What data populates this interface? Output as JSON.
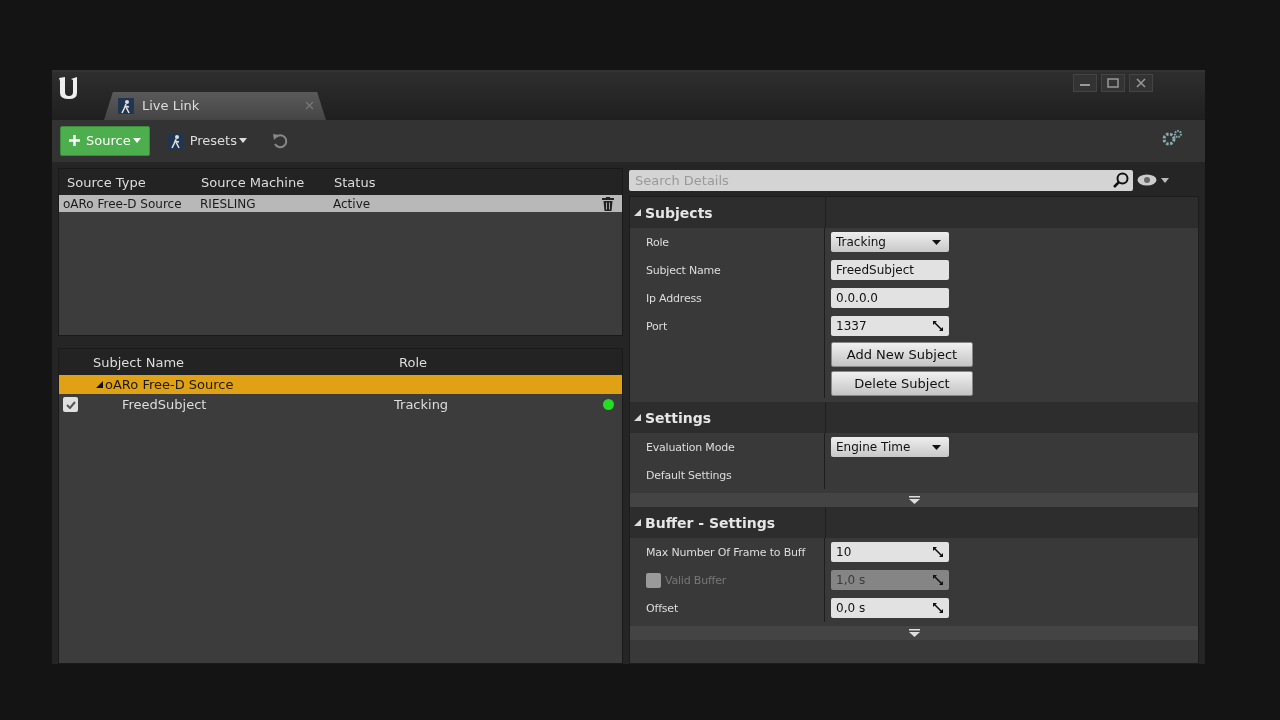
{
  "window": {
    "tab": {
      "label": "Live Link",
      "selected": true
    }
  },
  "toolbar": {
    "source_button": "Source",
    "presets_button": "Presets"
  },
  "sources": {
    "columns": [
      "Source Type",
      "Source Machine",
      "Status"
    ],
    "rows": [
      {
        "cells": [
          "oARo Free-D Source",
          "RIESLING",
          "Active"
        ],
        "selected": true
      }
    ]
  },
  "subjects": {
    "columns": [
      "Subject Name",
      "Role"
    ],
    "groups": [
      {
        "label": "oARo Free-D Source",
        "expanded": true,
        "selected": true,
        "children": [
          {
            "name": "FreedSubject",
            "role": "Tracking",
            "checked": true,
            "color": "#22dd22"
          }
        ]
      }
    ]
  },
  "details": {
    "search": {
      "placeholder": "Search Details"
    },
    "sections": [
      {
        "title": "Subjects",
        "expanded": true,
        "has_more": false,
        "rows": [
          {
            "kind": "dropdown",
            "label": "Role",
            "value": "Tracking"
          },
          {
            "kind": "text",
            "label": "Subject Name",
            "value": "FreedSubject"
          },
          {
            "kind": "text",
            "label": "Ip Address",
            "value": "0.0.0.0"
          },
          {
            "kind": "spin",
            "label": "Port",
            "value": "1337"
          },
          {
            "kind": "button",
            "label": "Add New Subject"
          },
          {
            "kind": "button",
            "label": "Delete Subject"
          }
        ]
      },
      {
        "title": "Settings",
        "expanded": true,
        "has_more": true,
        "rows": [
          {
            "kind": "dropdown",
            "label": "Evaluation Mode",
            "value": "Engine Time"
          },
          {
            "kind": "label",
            "label": "Default Settings"
          }
        ]
      },
      {
        "title": "Buffer - Settings",
        "expanded": true,
        "has_more": true,
        "rows": [
          {
            "kind": "spin",
            "label": "Max Number Of Frame to Buff",
            "value": "10"
          },
          {
            "kind": "spin",
            "label": "Valid Buffer",
            "value": "1,0 s",
            "checked": false,
            "disabled": true
          },
          {
            "kind": "spin",
            "label": "Offset",
            "value": "0,0 s"
          }
        ]
      }
    ]
  }
}
